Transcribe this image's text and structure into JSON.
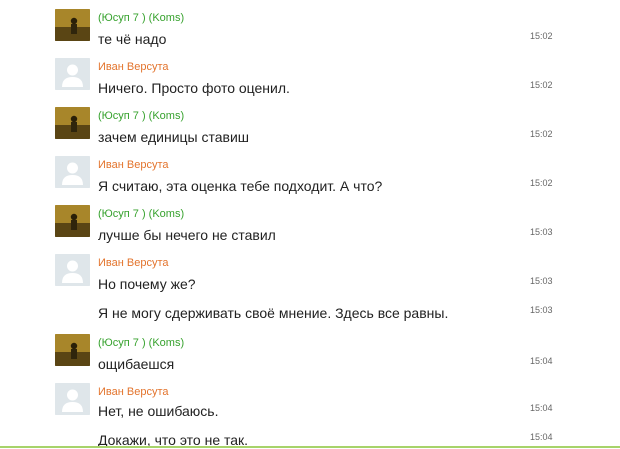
{
  "messages": [
    {
      "author": "(Юсуп 7 ) (Koms)",
      "author_color": "#37a22e",
      "avatar": "photo",
      "text": "те чё надо",
      "time": "15:02"
    },
    {
      "author": "Иван Версута",
      "author_color": "#e3742d",
      "avatar": "default",
      "text": "Ничего. Просто фото оценил.",
      "time": "15:02"
    },
    {
      "author": "(Юсуп 7 ) (Koms)",
      "author_color": "#37a22e",
      "avatar": "photo",
      "text": "зачем единицы ставиш",
      "time": "15:02"
    },
    {
      "author": "Иван Версута",
      "author_color": "#e3742d",
      "avatar": "default",
      "text": "Я считаю, эта оценка тебе подходит. А что?",
      "time": "15:02"
    },
    {
      "author": "(Юсуп 7 ) (Koms)",
      "author_color": "#37a22e",
      "avatar": "photo",
      "text": "лучше бы нечего не ставил",
      "time": "15:03"
    },
    {
      "author": "Иван Версута",
      "author_color": "#e3742d",
      "avatar": "default",
      "text": "Но почему же?",
      "time": "15:03",
      "extra_text": "Я не могу сдерживать своё мнение. Здесь все равны.",
      "extra_time": "15:03"
    },
    {
      "author": "(Юсуп 7 ) (Koms)",
      "author_color": "#37a22e",
      "avatar": "photo",
      "text": "ощибаешся",
      "time": "15:04"
    },
    {
      "author": "Иван Версута",
      "author_color": "#e3742d",
      "avatar": "default",
      "text": "Нет, не ошибаюсь.",
      "time": "15:04",
      "extra_text": "Докажи, что это не так.",
      "extra_time": "15:04"
    }
  ]
}
